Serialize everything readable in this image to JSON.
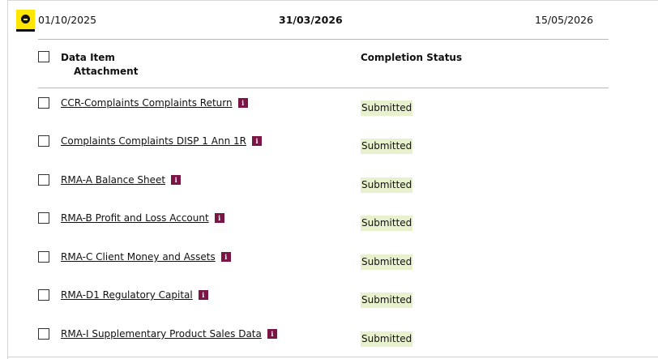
{
  "period": {
    "start_date": "01/10/2025",
    "due_date": "31/03/2026",
    "end_date": "15/05/2026",
    "toggle_icon": "minus-circle-icon",
    "toggle_color": "#ffe500"
  },
  "table": {
    "headers": {
      "data_item": "Data Item",
      "attachment": "Attachment",
      "completion_status": "Completion Status"
    },
    "info_icon_label": "i",
    "info_icon_color": "#7a1545",
    "status_highlight_color": "#e8f1cd",
    "rows": [
      {
        "name": "CCR-Complaints Complaints Return",
        "status": "Submitted"
      },
      {
        "name": "Complaints Complaints DISP 1 Ann 1R",
        "status": "Submitted"
      },
      {
        "name": "RMA-A Balance Sheet",
        "status": "Submitted"
      },
      {
        "name": "RMA-B Profit and Loss Account",
        "status": "Submitted"
      },
      {
        "name": "RMA-C Client Money and Assets",
        "status": "Submitted"
      },
      {
        "name": "RMA-D1 Regulatory Capital",
        "status": "Submitted"
      },
      {
        "name": "RMA-I Supplementary Product Sales Data",
        "status": "Submitted"
      }
    ]
  }
}
